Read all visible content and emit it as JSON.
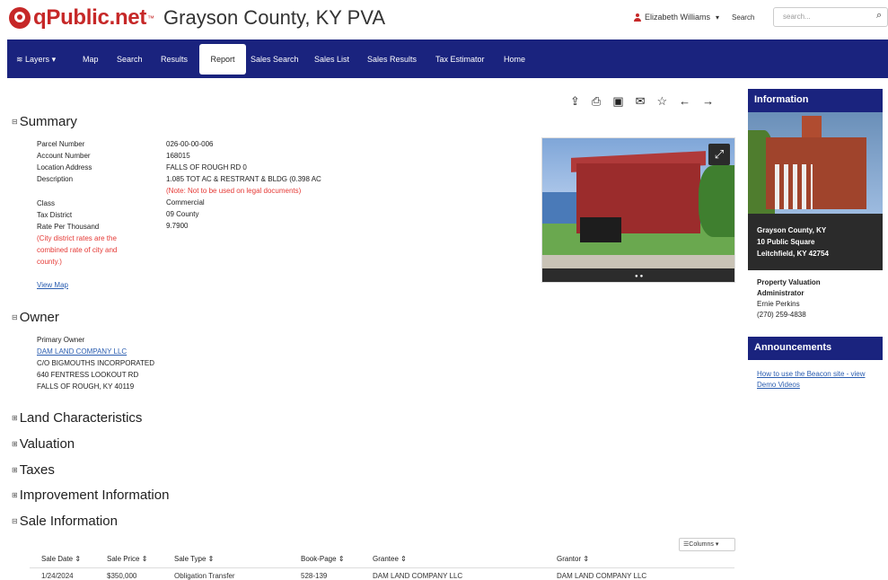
{
  "header": {
    "logo_text": "qPublic.net",
    "logo_tm": "™",
    "county_title": "Grayson County, KY PVA",
    "user_name": "Elizabeth Williams",
    "search_label": "Search",
    "search_placeholder": "search..."
  },
  "nav": {
    "layers": "Layers",
    "map": "Map",
    "search": "Search",
    "results": "Results",
    "report": "Report",
    "sales_search": "Sales Search",
    "sales_list": "Sales List",
    "sales_results": "Sales Results",
    "tax_estimator": "Tax Estimator",
    "home": "Home"
  },
  "summary": {
    "title": "Summary",
    "labels": [
      "Parcel Number",
      "Account Number",
      "Location Address",
      "Description",
      "Class",
      "Tax District",
      "Rate Per Thousand"
    ],
    "values": [
      "026-00-00-006",
      "168015",
      "FALLS OF ROUGH RD 0",
      "1.085 TOT AC & RESTRANT & BLDG (0.398 AC",
      "Commercial",
      "09 County",
      "9.7900"
    ],
    "description_note": "(Note: Not to be used on legal documents)",
    "rate_note": "(City district rates are the combined rate of city and county.)",
    "view_map": "View Map"
  },
  "owner": {
    "title": "Owner",
    "label": "Primary Owner",
    "name": "DAM LAND COMPANY LLC",
    "line1": "C/O BIGMOUTHS INCORPORATED",
    "line2": "640 FENTRESS LOOKOUT RD",
    "line3": "FALLS OF ROUGH, KY 40119"
  },
  "sections": {
    "land": "Land Characteristics",
    "valuation": "Valuation",
    "taxes": "Taxes",
    "improvement": "Improvement Information",
    "sale": "Sale Information"
  },
  "sidebar": {
    "info_title": "Information",
    "addr1": "Grayson County, KY",
    "addr2": "10 Public Square",
    "addr3": "Leitchfield, KY 42754",
    "pva1": "Property Valuation",
    "pva2": "Administrator",
    "pva3": "Ernie Perkins",
    "pva4": "(270) 259-4838",
    "ann_title": "Announcements",
    "ann_link": "How to use the Beacon site - view Demo Videos"
  },
  "sales_table": {
    "columns_btn": "Columns",
    "headers": [
      "Sale Date",
      "Sale Price",
      "Sale Type",
      "Book-Page",
      "Grantee",
      "Grantor"
    ],
    "rows": [
      [
        "1/24/2024",
        "$350,000",
        "Obligation Transfer",
        "528-139",
        "DAM LAND COMPANY LLC",
        "DAM LAND COMPANY LLC"
      ]
    ]
  },
  "icons": [
    "share-icon",
    "print-icon",
    "image-icon",
    "email-icon",
    "star-icon",
    "arrow-left-icon",
    "arrow-right-icon"
  ],
  "colors": {
    "brand_red": "#c62828",
    "nav_blue": "#1a237e",
    "link": "#2a5db0",
    "note_red": "#e53935"
  }
}
